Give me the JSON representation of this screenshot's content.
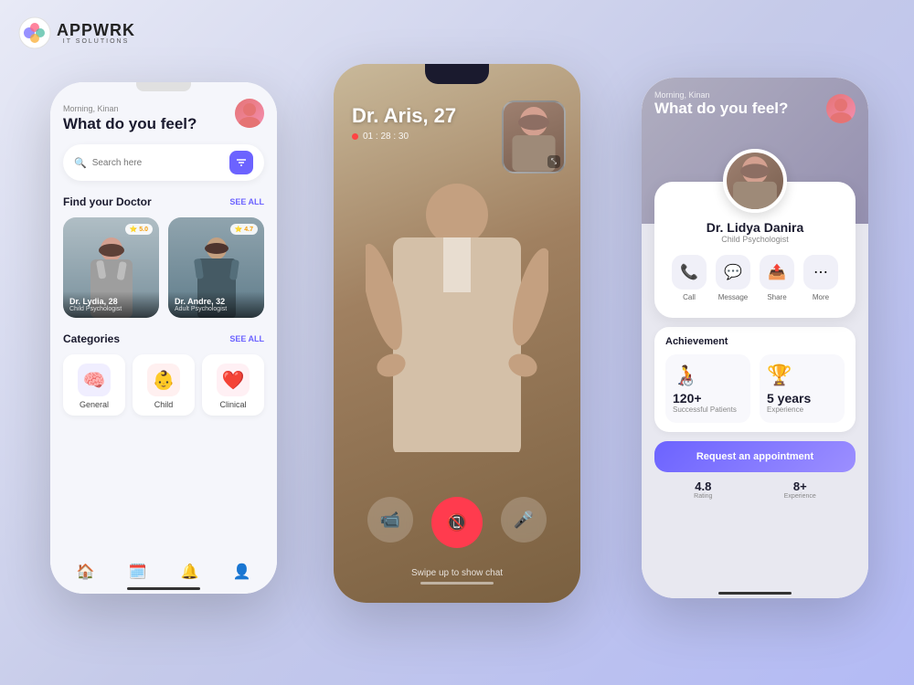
{
  "logo": {
    "text": "APPWRK",
    "sub": "IT SOLUTIONS"
  },
  "phone_left": {
    "greeting_small": "Morning, Kinan",
    "greeting_big": "What do you feel?",
    "search_placeholder": "Search here",
    "find_doctor": {
      "title": "Find your Doctor",
      "see_all": "SEE ALL",
      "doctors": [
        {
          "name": "Dr. Lydia, 28",
          "spec": "Child Psychologist",
          "rating": "5.0"
        },
        {
          "name": "Dr. Andre, 32",
          "spec": "Adult Psychologist",
          "rating": "4.7"
        }
      ]
    },
    "categories": {
      "title": "Categories",
      "see_all": "SEE ALL",
      "items": [
        {
          "label": "General",
          "icon": "🧠"
        },
        {
          "label": "Child",
          "icon": "👶"
        },
        {
          "label": "Clinical",
          "icon": "❤️"
        }
      ]
    }
  },
  "phone_middle": {
    "caller_name": "Dr. Aris, 27",
    "timer": "01 : 28 : 30",
    "swipe_hint": "Swipe up to show chat"
  },
  "phone_right": {
    "greeting_small": "Morning, Kinan",
    "greeting_big": "What do you feel?",
    "doctor": {
      "name": "Dr. Lidya Danira",
      "spec": "Child Psychologist"
    },
    "actions": [
      {
        "label": "Call",
        "icon": "📞"
      },
      {
        "label": "Message",
        "icon": "💬"
      },
      {
        "label": "Share",
        "icon": "📤"
      },
      {
        "label": "More",
        "icon": "⋯"
      }
    ],
    "achievement": {
      "title": "Achievement",
      "items": [
        {
          "num": "120+",
          "desc": "Successful Patients",
          "icon": "🧑‍🦽"
        },
        {
          "num": "5 years",
          "desc": "Experience",
          "icon": "🏆"
        }
      ]
    },
    "request_btn": "Request an appointment",
    "stats": [
      {
        "num": "4.8",
        "label": "Rating"
      },
      {
        "num": "8+",
        "label": "Experience"
      }
    ]
  }
}
